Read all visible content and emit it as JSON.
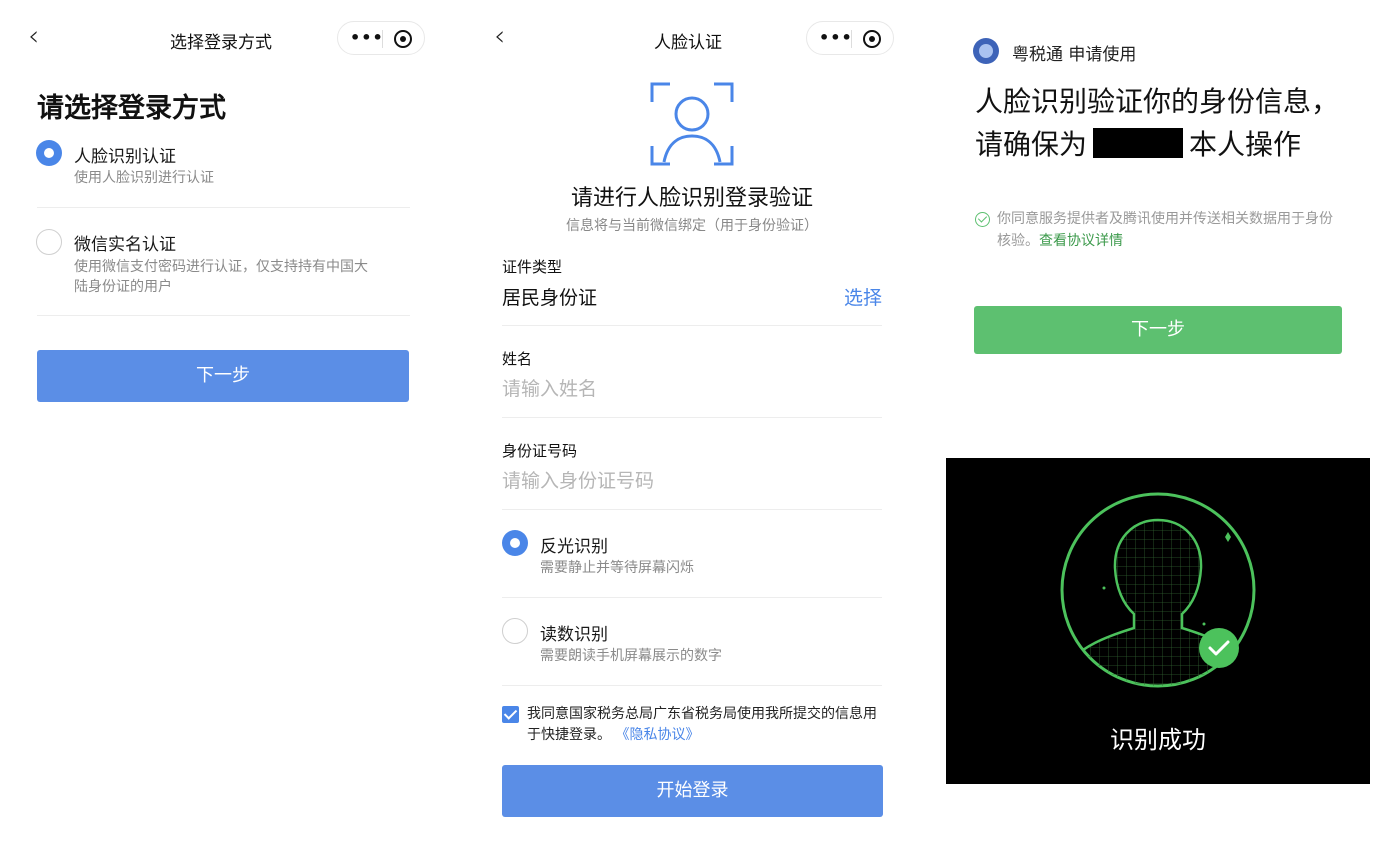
{
  "screen1": {
    "nav_title": "选择登录方式",
    "heading": "请选择登录方式",
    "options": [
      {
        "title": "人脸识别认证",
        "subtitle": "使用人脸识别进行认证",
        "selected": true
      },
      {
        "title": "微信实名认证",
        "subtitle_line1": "使用微信支付密码进行认证，仅支持持有中国大",
        "subtitle_line2": "陆身份证的用户",
        "selected": false
      }
    ],
    "next_button": "下一步"
  },
  "screen2": {
    "nav_title": "人脸认证",
    "title": "请进行人脸识别登录验证",
    "subtitle": "信息将与当前微信绑定（用于身份验证）",
    "id_type": {
      "label": "证件类型",
      "value": "居民身份证",
      "action": "选择"
    },
    "name": {
      "label": "姓名",
      "placeholder": "请输入姓名"
    },
    "id_number": {
      "label": "身份证号码",
      "placeholder": "请输入身份证号码"
    },
    "modes": [
      {
        "title": "反光识别",
        "subtitle": "需要静止并等待屏幕闪烁",
        "selected": true
      },
      {
        "title": "读数识别",
        "subtitle": "需要朗读手机屏幕展示的数字",
        "selected": false
      }
    ],
    "agreement_text": "我同意国家税务总局广东省税务局使用我所提交的信息用于快捷登录。",
    "agreement_link": "《隐私协议》",
    "agreement_checked": true,
    "login_button": "开始登录"
  },
  "screen3": {
    "app_name": "粤税通 申请使用",
    "title_line1": "人脸识别验证你的身份信息，",
    "title_line2_prefix": "请确保为",
    "title_line2_suffix": "本人操作",
    "consent_text": "你同意服务提供者及腾讯使用并传送相关数据用于身份核验。",
    "consent_link": "查看协议详情",
    "next_button": "下一步",
    "result_text": "识别成功"
  },
  "colors": {
    "primary_blue": "#5b8ee6",
    "link_blue": "#4a86e8",
    "primary_green": "#5dc070",
    "success_green": "#4cc25c"
  }
}
